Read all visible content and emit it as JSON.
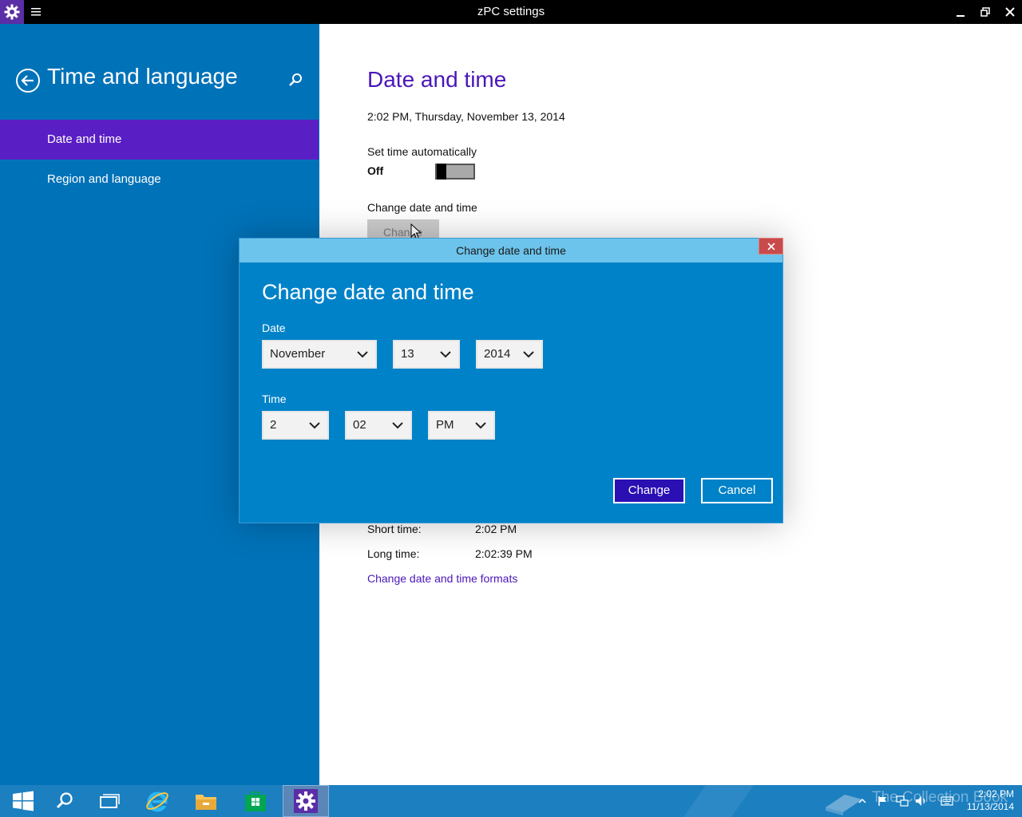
{
  "window": {
    "title": "zPC settings",
    "app_icon": "gear-icon",
    "menu_icon": "hamburger-icon",
    "buttons": [
      "minimize-icon",
      "restore-icon",
      "close-icon"
    ]
  },
  "sidebar": {
    "title": "Time and language",
    "back_icon": "back-arrow-icon",
    "search_icon": "search-icon",
    "items": [
      {
        "label": "Date and time",
        "selected": true
      },
      {
        "label": "Region and language",
        "selected": false
      }
    ]
  },
  "main": {
    "heading": "Date and time",
    "current_datetime": "2:02 PM, Thursday, November 13, 2014",
    "set_time_auto_label": "Set time automatically",
    "set_time_auto_state": "Off",
    "change_section_label": "Change date and time",
    "change_button_label": "Change",
    "short_time_label": "Short time:",
    "short_time_value": "2:02 PM",
    "long_time_label": "Long time:",
    "long_time_value": "2:02:39 PM",
    "formats_link": "Change date and time formats"
  },
  "dialog": {
    "title": "Change date and time",
    "heading": "Change date and time",
    "date_label": "Date",
    "month": "November",
    "day": "13",
    "year": "2014",
    "time_label": "Time",
    "hour": "2",
    "minute": "02",
    "ampm": "PM",
    "change_label": "Change",
    "cancel_label": "Cancel"
  },
  "taskbar": {
    "items": [
      "start-icon",
      "search-icon",
      "task-view-icon",
      "internet-explorer-icon",
      "file-explorer-icon",
      "store-icon",
      "settings-icon"
    ],
    "active_item": "settings-icon",
    "clock_time": "2:02 PM",
    "clock_date": "11/13/2014",
    "watermark": "The Collection Book"
  },
  "colors": {
    "sidebar_bg": "#0072b8",
    "sidebar_selected": "#5a1fc4",
    "accent_text": "#4a16b8",
    "dialog_bg": "#0082c8",
    "dialog_titlebar": "#6cc3eb",
    "primary_button": "#2a0fb3",
    "taskbar_bg": "#1c7fc0"
  }
}
